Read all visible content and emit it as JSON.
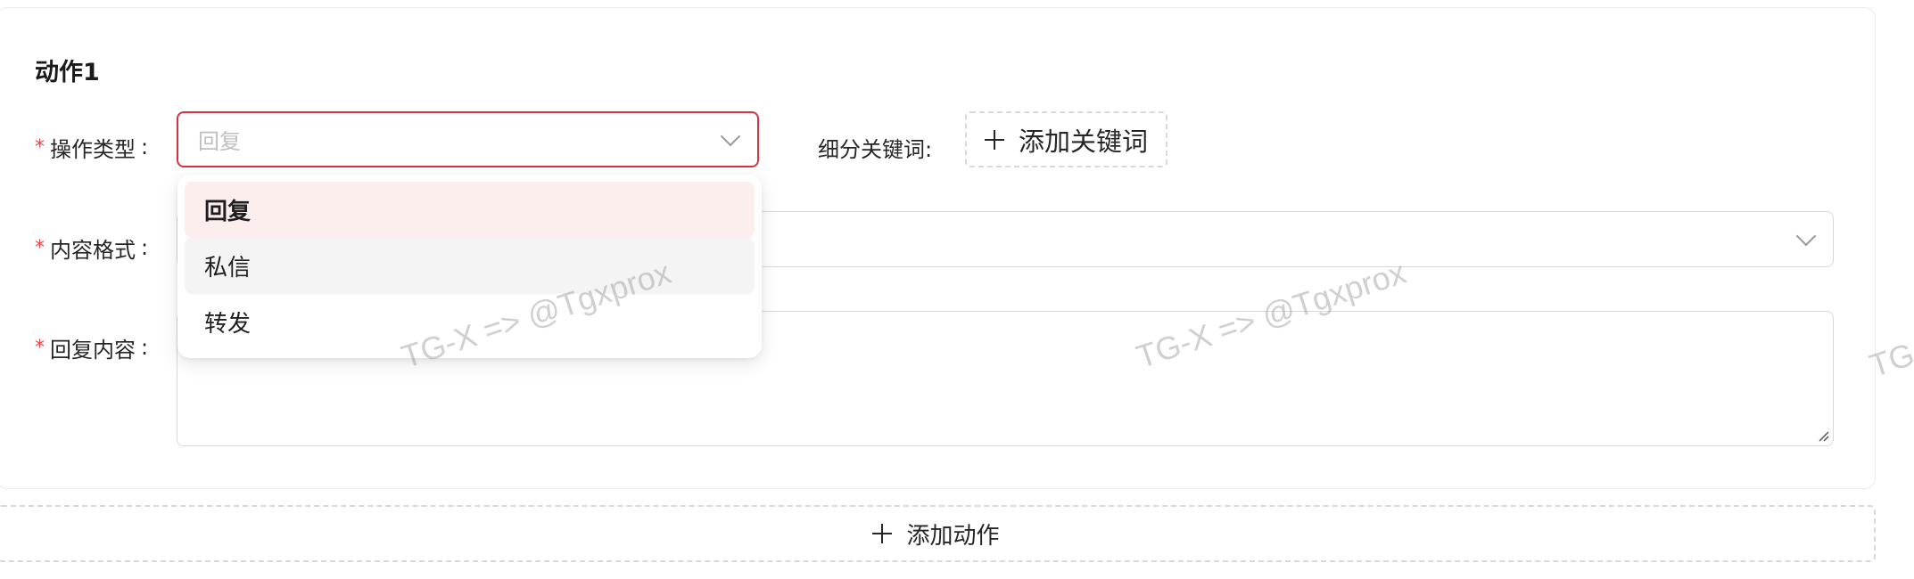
{
  "card": {
    "title": "动作1"
  },
  "form": {
    "required_mark": "*",
    "colon": ":",
    "operation_type": {
      "label": "操作类型",
      "value": "回复",
      "focused": true
    },
    "keywords": {
      "label": "细分关键词:",
      "add_button": "添加关键词"
    },
    "content_format": {
      "label": "内容格式",
      "value": ""
    },
    "reply_content": {
      "label": "回复内容",
      "value": ""
    }
  },
  "dropdown": {
    "options": [
      {
        "label": "回复",
        "state": "selected"
      },
      {
        "label": "私信",
        "state": "hover"
      },
      {
        "label": "转发",
        "state": "normal"
      }
    ]
  },
  "add_action_button": {
    "label": "添加动作"
  },
  "watermark": {
    "text": "TG-X => @Tgxprox",
    "partial": "TG"
  },
  "colors": {
    "accent": "#d4333f",
    "required": "#e5484d",
    "selected_bg": "#fdeeee",
    "hover_bg": "#f4f4f4"
  }
}
